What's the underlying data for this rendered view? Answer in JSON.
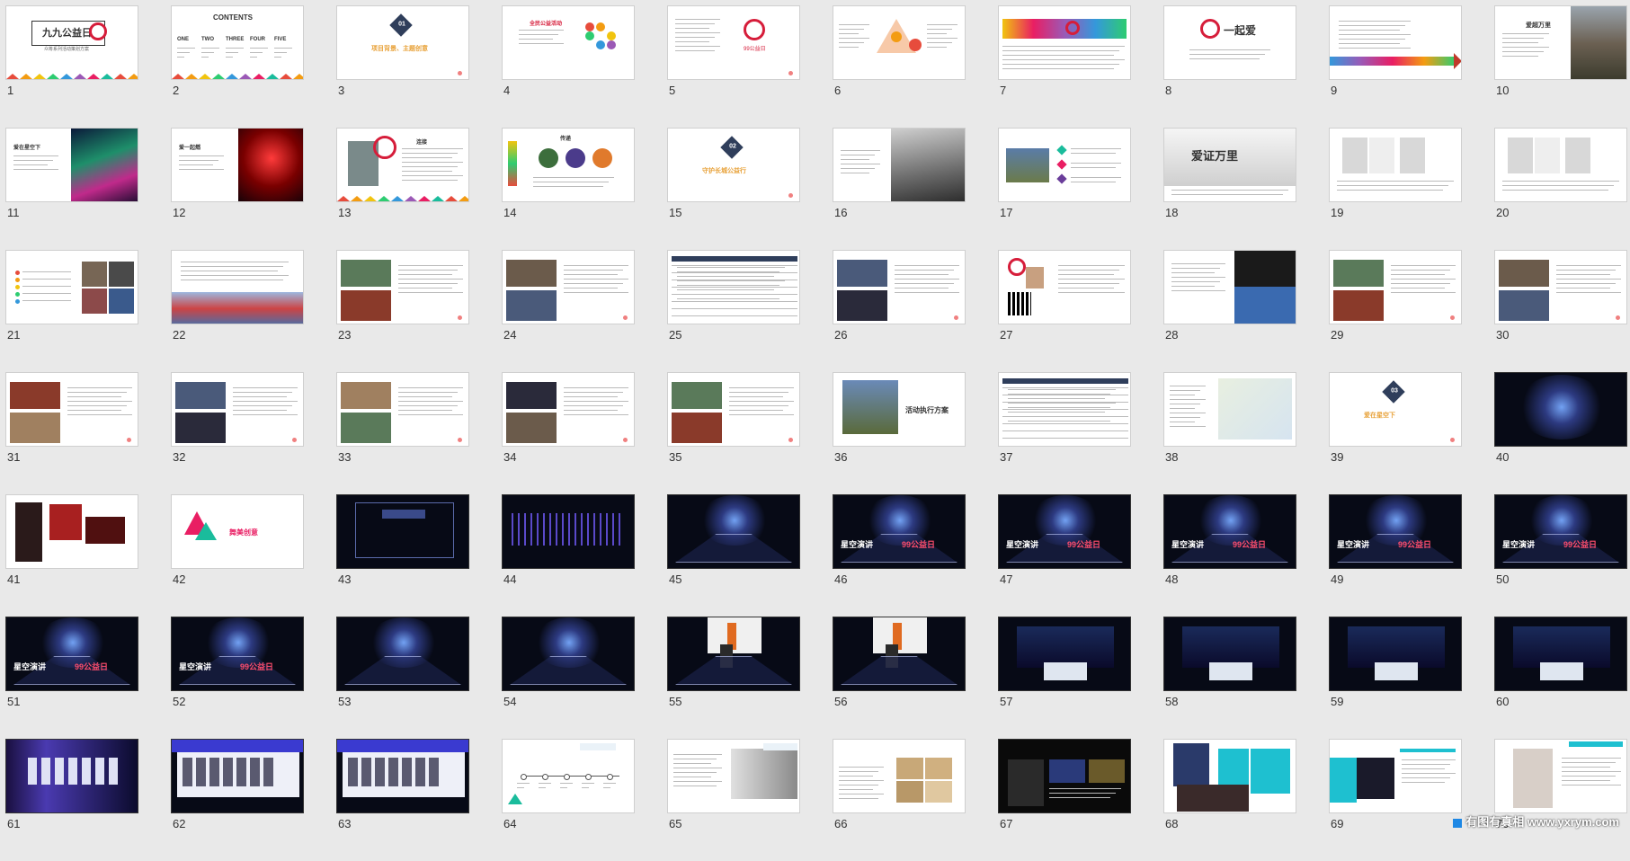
{
  "slides": [
    {
      "n": "1",
      "kind": "cover",
      "title": "九九公益日",
      "subtitle": "众筹系列活动策划方案"
    },
    {
      "n": "2",
      "kind": "contents",
      "title": "CONTENTS",
      "items": [
        "ONE",
        "TWO",
        "THREE",
        "FOUR",
        "FIVE"
      ]
    },
    {
      "n": "3",
      "kind": "section",
      "badge": "01",
      "caption": "项目背景、主题创意"
    },
    {
      "n": "4",
      "kind": "plain",
      "caption": "全民公益活动"
    },
    {
      "n": "5",
      "kind": "heart",
      "caption": "99公益日"
    },
    {
      "n": "6",
      "kind": "tri"
    },
    {
      "n": "7",
      "kind": "banner"
    },
    {
      "n": "8",
      "kind": "logo",
      "caption": "一起爱"
    },
    {
      "n": "9",
      "kind": "arrow"
    },
    {
      "n": "10",
      "kind": "wall",
      "caption": "爱超万里"
    },
    {
      "n": "11",
      "kind": "aurora",
      "caption": "爱在星空下"
    },
    {
      "n": "12",
      "kind": "red",
      "caption": "爱一起燃"
    },
    {
      "n": "13",
      "kind": "heart2",
      "caption": "连接"
    },
    {
      "n": "14",
      "kind": "circles",
      "caption": "传递"
    },
    {
      "n": "15",
      "kind": "section",
      "badge": "02",
      "caption": "守护长城公益行"
    },
    {
      "n": "16",
      "kind": "wallbw"
    },
    {
      "n": "17",
      "kind": "wallcolor"
    },
    {
      "n": "18",
      "kind": "ink",
      "caption": "爱证万里"
    },
    {
      "n": "19",
      "kind": "phones"
    },
    {
      "n": "20",
      "kind": "phones"
    },
    {
      "n": "21",
      "kind": "list"
    },
    {
      "n": "22",
      "kind": "crowd"
    },
    {
      "n": "23",
      "kind": "photos"
    },
    {
      "n": "24",
      "kind": "photos"
    },
    {
      "n": "25",
      "kind": "table"
    },
    {
      "n": "26",
      "kind": "photos"
    },
    {
      "n": "27",
      "kind": "qr"
    },
    {
      "n": "28",
      "kind": "poster"
    },
    {
      "n": "29",
      "kind": "photos"
    },
    {
      "n": "30",
      "kind": "photos"
    },
    {
      "n": "31",
      "kind": "photos"
    },
    {
      "n": "32",
      "kind": "photos"
    },
    {
      "n": "33",
      "kind": "photos"
    },
    {
      "n": "34",
      "kind": "photos"
    },
    {
      "n": "35",
      "kind": "photos"
    },
    {
      "n": "36",
      "kind": "exec",
      "caption": "活动执行方案"
    },
    {
      "n": "37",
      "kind": "table"
    },
    {
      "n": "38",
      "kind": "map"
    },
    {
      "n": "39",
      "kind": "section",
      "badge": "03",
      "caption": "爱在星空下"
    },
    {
      "n": "40",
      "kind": "galaxy"
    },
    {
      "n": "41",
      "kind": "portrait"
    },
    {
      "n": "42",
      "kind": "beauty",
      "caption": "舞美创意"
    },
    {
      "n": "43",
      "kind": "dark"
    },
    {
      "n": "44",
      "kind": "darkstripe"
    },
    {
      "n": "45",
      "kind": "stage"
    },
    {
      "n": "46",
      "kind": "stage",
      "left": "星空演讲",
      "right": "99公益日"
    },
    {
      "n": "47",
      "kind": "stage",
      "left": "星空演讲",
      "right": "99公益日"
    },
    {
      "n": "48",
      "kind": "stage",
      "left": "星空演讲",
      "right": "99公益日"
    },
    {
      "n": "49",
      "kind": "stage",
      "left": "星空演讲",
      "right": "99公益日"
    },
    {
      "n": "50",
      "kind": "stage",
      "left": "星空演讲",
      "right": "99公益日"
    },
    {
      "n": "51",
      "kind": "stage",
      "left": "星空演讲",
      "right": "99公益日"
    },
    {
      "n": "52",
      "kind": "stage",
      "left": "星空演讲",
      "right": "99公益日"
    },
    {
      "n": "53",
      "kind": "stage"
    },
    {
      "n": "54",
      "kind": "stage"
    },
    {
      "n": "55",
      "kind": "stagewhite"
    },
    {
      "n": "56",
      "kind": "stagewhite"
    },
    {
      "n": "57",
      "kind": "room"
    },
    {
      "n": "58",
      "kind": "room"
    },
    {
      "n": "59",
      "kind": "room"
    },
    {
      "n": "60",
      "kind": "room"
    },
    {
      "n": "61",
      "kind": "hall"
    },
    {
      "n": "62",
      "kind": "gallery"
    },
    {
      "n": "63",
      "kind": "gallery"
    },
    {
      "n": "64",
      "kind": "timeline"
    },
    {
      "n": "65",
      "kind": "person"
    },
    {
      "n": "66",
      "kind": "textimg"
    },
    {
      "n": "67",
      "kind": "dark2"
    },
    {
      "n": "68",
      "kind": "teal"
    },
    {
      "n": "69",
      "kind": "teal2"
    },
    {
      "n": "70",
      "kind": "person2"
    }
  ],
  "watermark": "有图有真相 www.yxrym.com",
  "colors": {
    "accent_red": "#d61d3a",
    "navy": "#2f3e5b",
    "bg": "#e9e9e9"
  }
}
